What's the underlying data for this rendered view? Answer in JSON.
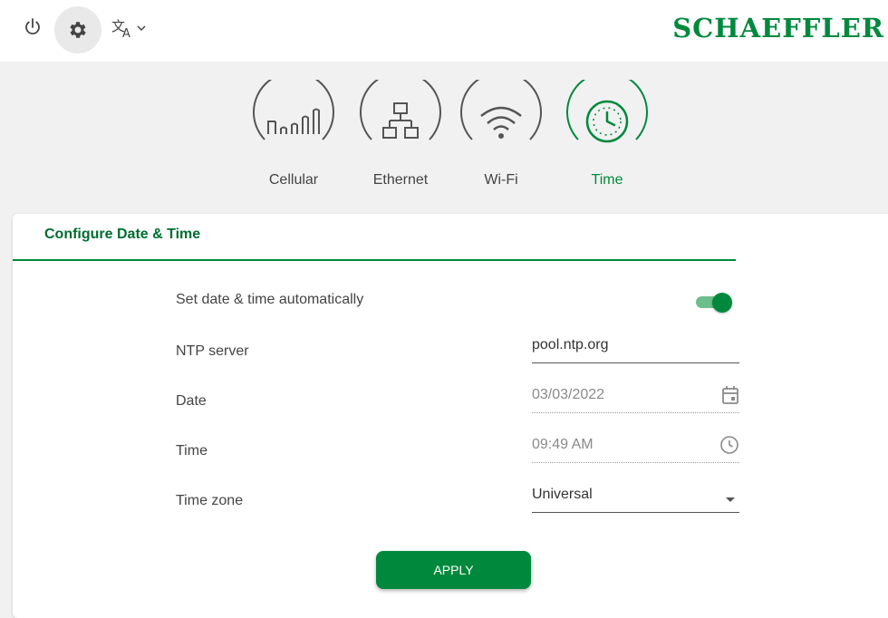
{
  "header": {
    "brand": "SCHAEFFLER",
    "power_icon": "power-icon",
    "settings_icon": "gear-icon",
    "language_icon": "translate-icon"
  },
  "tabs": [
    {
      "label": "Cellular",
      "icon": "cellular-signal-icon",
      "active": false
    },
    {
      "label": "Ethernet",
      "icon": "ethernet-network-icon",
      "active": false
    },
    {
      "label": "Wi-Fi",
      "icon": "wifi-icon",
      "active": false
    },
    {
      "label": "Time",
      "icon": "clock-icon",
      "active": true
    }
  ],
  "card": {
    "title": "Configure Date & Time",
    "rows": {
      "auto": {
        "label": "Set date & time automatically",
        "value": true
      },
      "ntp": {
        "label": "NTP server",
        "value": "pool.ntp.org"
      },
      "date": {
        "label": "Date",
        "value": "03/03/2022",
        "icon": "calendar-icon"
      },
      "time": {
        "label": "Time",
        "value": "09:49 AM",
        "icon": "clock-icon"
      },
      "timezone": {
        "label": "Time zone",
        "value": "Universal",
        "icon": "dropdown-arrow-icon"
      }
    },
    "apply_label": "APPLY"
  },
  "colors": {
    "accent": "#00893d",
    "accent_light": "#6cbf8b",
    "title": "#006d32",
    "background": "#f1f1f1"
  }
}
